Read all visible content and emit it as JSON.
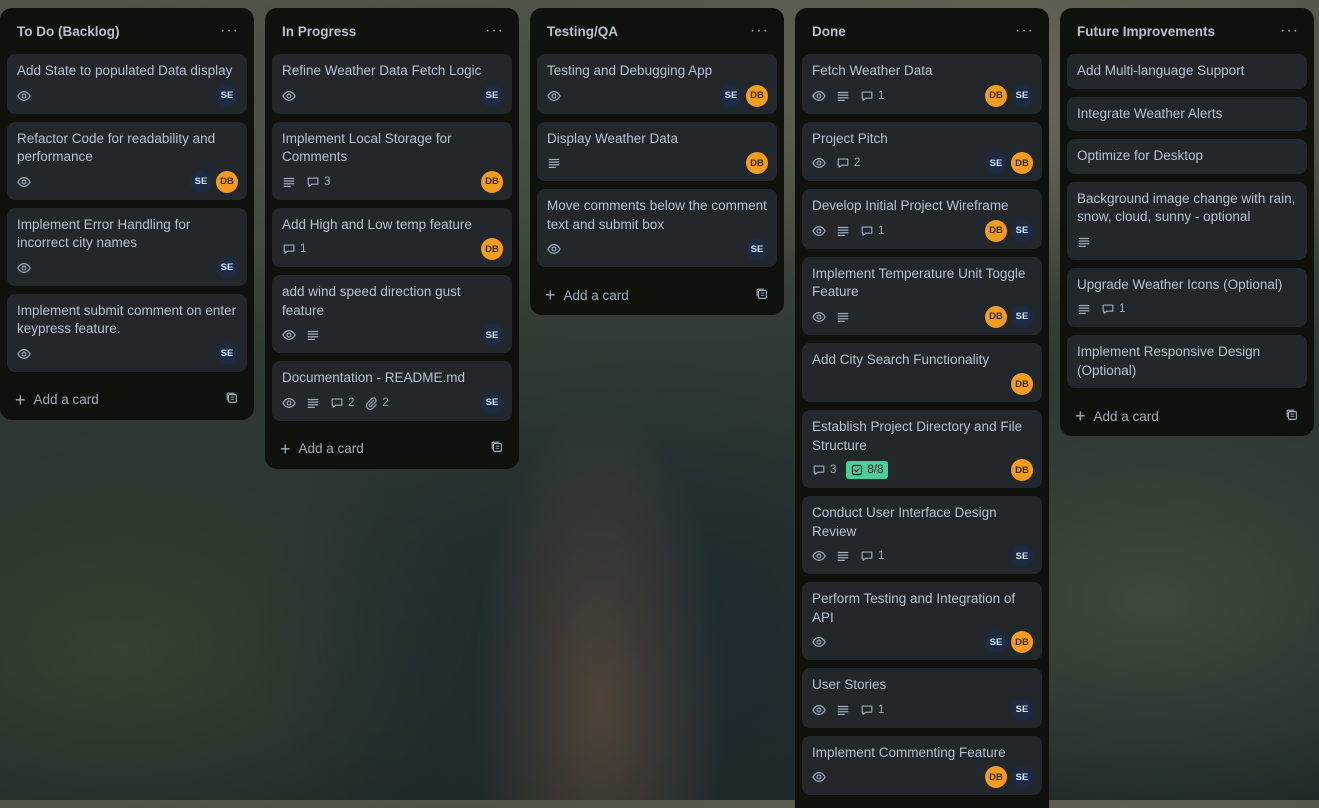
{
  "lists": [
    {
      "title": "To Do (Backlog)",
      "add_card": "Add a card",
      "cards": [
        {
          "title": "Add State to populated Data display"
        },
        {
          "title": "Refactor Code for readability and performance"
        },
        {
          "title": "Implement Error Handling for incorrect city names"
        },
        {
          "title": "Implement submit comment on enter keypress feature."
        }
      ]
    },
    {
      "title": "In Progress",
      "add_card": "Add a card",
      "cards": [
        {
          "title": "Refine Weather Data Fetch Logic"
        },
        {
          "title": "Implement Local Storage for Comments",
          "comments": "3"
        },
        {
          "title": "Add High and Low temp feature",
          "comments": "1"
        },
        {
          "title": "add wind speed direction gust feature"
        },
        {
          "title": "Documentation - README.md",
          "comments": "2",
          "attachments": "2"
        }
      ]
    },
    {
      "title": "Testing/QA",
      "add_card": "Add a card",
      "cards": [
        {
          "title": "Testing and Debugging App"
        },
        {
          "title": "Display Weather Data"
        },
        {
          "title": "Move comments below the comment text and submit box"
        }
      ]
    },
    {
      "title": "Done",
      "add_card": "Add a card",
      "cards": [
        {
          "title": "Fetch Weather Data",
          "comments": "1"
        },
        {
          "title": "Project Pitch",
          "comments": "2"
        },
        {
          "title": "Develop Initial Project Wireframe",
          "comments": "1"
        },
        {
          "title": "Implement Temperature Unit Toggle Feature"
        },
        {
          "title": "Add City Search Functionality"
        },
        {
          "title": "Establish Project Directory and File Structure",
          "comments": "3",
          "checklist": "8/8"
        },
        {
          "title": "Conduct User Interface Design Review",
          "comments": "1"
        },
        {
          "title": "Perform Testing and Integration of API"
        },
        {
          "title": "User Stories",
          "comments": "1"
        },
        {
          "title": "Implement Commenting Feature"
        }
      ]
    },
    {
      "title": "Future Improvements",
      "add_card": "Add a card",
      "cards": [
        {
          "title": "Add Multi-language Support"
        },
        {
          "title": "Integrate Weather Alerts"
        },
        {
          "title": "Optimize for Desktop"
        },
        {
          "title": "Background image change with rain, snow, cloud, sunny - optional"
        },
        {
          "title": "Upgrade Weather Icons (Optional)",
          "comments": "1"
        },
        {
          "title": "Implement Responsive Design (Optional)"
        }
      ]
    }
  ],
  "members": {
    "se": "SE",
    "db": "DB"
  },
  "list_menu_glyph": "···",
  "icons": [
    "eye-icon",
    "description-icon",
    "comment-icon",
    "attachment-icon",
    "checklist-icon",
    "plus-icon",
    "template-icon",
    "menu-icon"
  ],
  "colors": {
    "list_bg": "#0f110c",
    "card_bg": "#22272b",
    "text": "#b6c2cf",
    "se_avatar": "#1c2b41",
    "db_avatar": "#f39c1f",
    "checklist_complete": "#4bce97"
  }
}
